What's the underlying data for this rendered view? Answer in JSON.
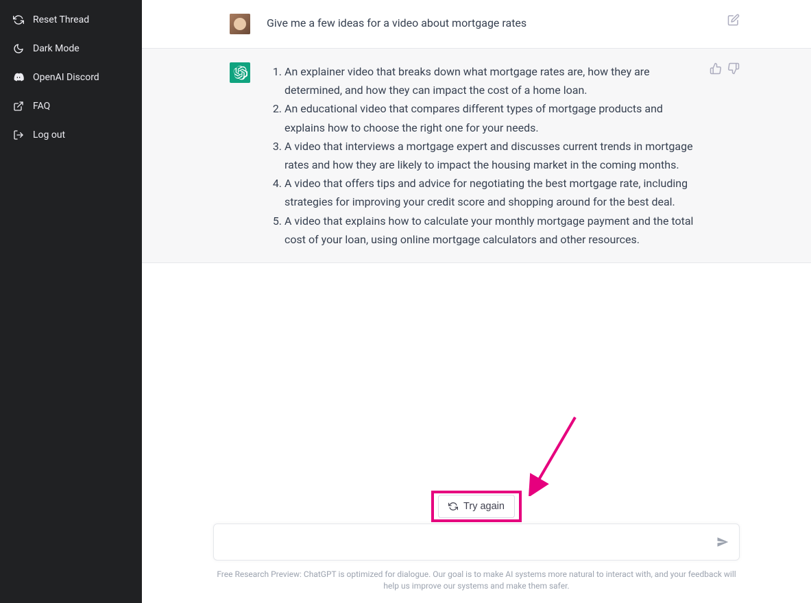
{
  "sidebar": {
    "items": [
      {
        "label": "Reset Thread",
        "icon": "refresh-icon"
      },
      {
        "label": "Dark Mode",
        "icon": "moon-icon"
      },
      {
        "label": "OpenAI Discord",
        "icon": "discord-icon"
      },
      {
        "label": "FAQ",
        "icon": "external-link-icon"
      },
      {
        "label": "Log out",
        "icon": "logout-icon"
      }
    ]
  },
  "conversation": {
    "user_message": "Give me a few ideas for a video about mortgage rates",
    "assistant_list": [
      "An explainer video that breaks down what mortgage rates are, how they are determined, and how they can impact the cost of a home loan.",
      "An educational video that compares different types of mortgage products and explains how to choose the right one for your needs.",
      "A video that interviews a mortgage expert and discusses current trends in mortgage rates and how they are likely to impact the housing market in the coming months.",
      "A video that offers tips and advice for negotiating the best mortgage rate, including strategies for improving your credit score and shopping around for the best deal.",
      "A video that explains how to calculate your monthly mortgage payment and the total cost of your loan, using online mortgage calculators and other resources."
    ]
  },
  "footer": {
    "try_again_label": "Try again",
    "input_placeholder": "",
    "disclaimer": "Free Research Preview: ChatGPT is optimized for dialogue. Our goal is to make AI systems more natural to interact with, and your feedback will help us improve our systems and make them safer."
  },
  "annotation": {
    "arrow_color": "#e6007e"
  }
}
